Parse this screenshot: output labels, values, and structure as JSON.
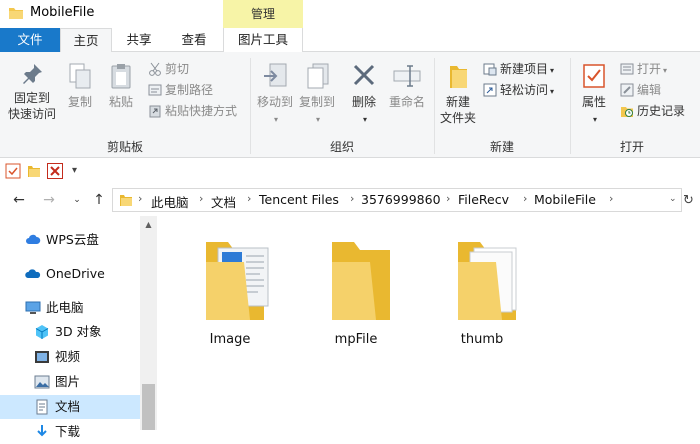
{
  "window": {
    "title": "MobileFile",
    "context_tab_header": "管理"
  },
  "tabs": {
    "file": "文件",
    "home": "主页",
    "share": "共享",
    "view": "查看",
    "picture_tools": "图片工具"
  },
  "ribbon": {
    "clipboard": {
      "label": "剪贴板",
      "pin_line1": "固定到",
      "pin_line2": "快速访问",
      "copy": "复制",
      "paste": "粘贴",
      "cut": "剪切",
      "copy_path": "复制路径",
      "paste_shortcut": "粘贴快捷方式"
    },
    "organize": {
      "label": "组织",
      "move_to": "移动到",
      "copy_to": "复制到",
      "delete": "删除",
      "rename": "重命名"
    },
    "new": {
      "label": "新建",
      "new_folder_line1": "新建",
      "new_folder_line2": "文件夹",
      "new_item": "新建项目",
      "easy_access": "轻松访问"
    },
    "open": {
      "label": "打开",
      "properties": "属性",
      "open": "打开",
      "edit": "编辑",
      "history": "历史记录"
    }
  },
  "address_bar": {
    "breadcrumbs": [
      "此电脑",
      "文档",
      "Tencent Files",
      "3576999860",
      "FileRecv",
      "MobileFile"
    ]
  },
  "nav_pane": {
    "items": [
      {
        "label": "WPS云盘",
        "icon": "cloud-icon"
      },
      {
        "label": "OneDrive",
        "icon": "onedrive-icon"
      },
      {
        "label": "此电脑",
        "icon": "computer-icon"
      },
      {
        "label": "3D 对象",
        "icon": "3d-objects-icon"
      },
      {
        "label": "视频",
        "icon": "video-icon"
      },
      {
        "label": "图片",
        "icon": "pictures-icon"
      },
      {
        "label": "文档",
        "icon": "documents-icon"
      },
      {
        "label": "下载",
        "icon": "downloads-icon"
      }
    ]
  },
  "files": [
    {
      "name": "Image",
      "icon": "folder-with-documents-icon"
    },
    {
      "name": "mpFile",
      "icon": "folder-icon"
    },
    {
      "name": "thumb",
      "icon": "folder-with-white-pages-icon"
    }
  ],
  "colors": {
    "file_tab": "#1979ca",
    "context_header": "#f7f4a7",
    "selection": "#cce8ff",
    "folder": "#f5d16a"
  }
}
